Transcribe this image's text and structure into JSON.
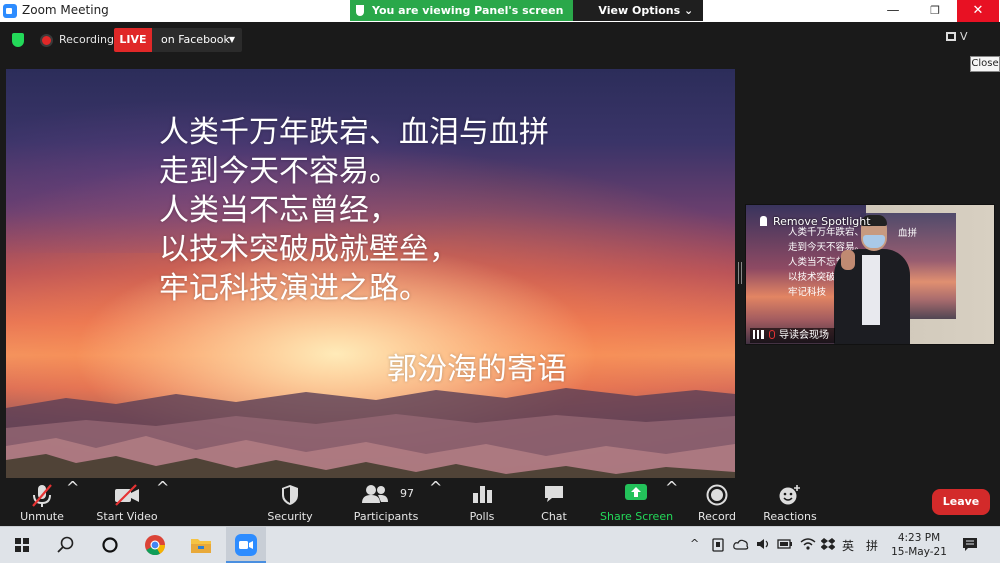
{
  "window": {
    "title": "Zoom Meeting",
    "minimize_glyph": "—",
    "maximize_glyph": "❐",
    "close_glyph": "✕"
  },
  "banner": {
    "viewing_text": "You are viewing Panel's screen",
    "view_options_label": "View Options",
    "caret": "⌄"
  },
  "meeting_bar": {
    "recording_label": "Recording",
    "live_badge": "LIVE",
    "stream_target": "on Facebook",
    "stream_caret": "▼",
    "view_button_label": "V",
    "close_tooltip": "Close"
  },
  "slide": {
    "lines": [
      "人类千万年跌宕、血泪与血拼",
      "走到今天不容易。",
      "人类当不忘曾经，",
      "以技术突破成就壁垒，",
      "牢记科技演进之路。"
    ],
    "signature": "郭汾海的寄语"
  },
  "video_thumb": {
    "remove_spotlight_label": "Remove Spotlight",
    "mini_lines": [
      "人类千万年跌宕、",
      "走到今天不容易。",
      "人类当不忘曾经",
      "以技术突破",
      "牢记科技"
    ],
    "mini_right": "血拼",
    "participant_name": "导读会现场"
  },
  "toolbar": {
    "unmute_label": "Unmute",
    "start_video_label": "Start Video",
    "security_label": "Security",
    "participants_label": "Participants",
    "participants_count": "97",
    "polls_label": "Polls",
    "chat_label": "Chat",
    "share_screen_label": "Share Screen",
    "record_label": "Record",
    "reactions_label": "Reactions",
    "leave_label": "Leave",
    "caret": "^"
  },
  "taskbar": {
    "time": "4:23 PM",
    "date": "15-May-21",
    "ime_lang": "英",
    "ime_mode": "拼",
    "tray_caret": "^"
  },
  "colors": {
    "live_red": "#e02828",
    "shield_green": "#23d959",
    "share_green": "#2aa84a",
    "leave_red": "#d32a2a",
    "zoom_blue": "#2d8cff"
  }
}
